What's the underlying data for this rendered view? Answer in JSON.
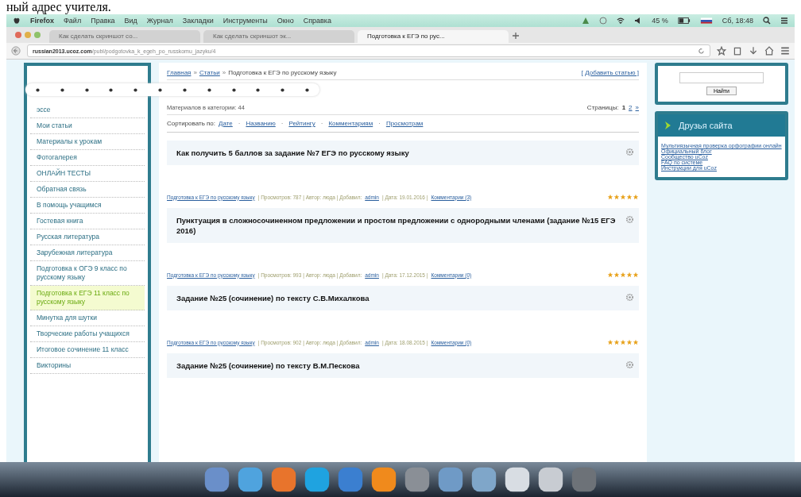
{
  "document_caption": "ный адрес учителя.",
  "menu_bar": {
    "app": "Firefox",
    "items": [
      "Файл",
      "Правка",
      "Вид",
      "Журнал",
      "Закладки",
      "Инструменты",
      "Окно",
      "Справка"
    ],
    "battery": "45 %",
    "clock": "Сб, 18:48"
  },
  "tabs": [
    {
      "title": "Как сделать скриншот со...",
      "selected": false
    },
    {
      "title": "Как сделать скриншот эк...",
      "selected": false
    },
    {
      "title": "Подготовка к ЕГЭ по рус...",
      "selected": true
    }
  ],
  "address_bar": {
    "host": "russian2013.ucoz.com",
    "path": "/publ/podgotovka_k_egeh_po_russkomu_jazyku/4"
  },
  "sidebar": {
    "items": [
      {
        "label": "эссе",
        "selected": false
      },
      {
        "label": "Мои статьи",
        "selected": false
      },
      {
        "label": "Материалы к урокам",
        "selected": false
      },
      {
        "label": "Фотогалерея",
        "selected": false
      },
      {
        "label": "ОНЛАЙН ТЕСТЫ",
        "selected": false
      },
      {
        "label": "Обратная связь",
        "selected": false
      },
      {
        "label": "В помощь учащимся",
        "selected": false
      },
      {
        "label": "Гостевая книга",
        "selected": false
      },
      {
        "label": "Русская литература",
        "selected": false
      },
      {
        "label": "Зарубежная литература",
        "selected": false
      },
      {
        "label": "Подготовка к ОГЭ 9 класс по русскому языку",
        "selected": false
      },
      {
        "label": "Подготовка к ЕГЭ 11 класс по русскому языку",
        "selected": true
      },
      {
        "label": "Минутка для шутки",
        "selected": false
      },
      {
        "label": "Творческие работы учащихся",
        "selected": false
      },
      {
        "label": "Итоговое сочинение 11 класс",
        "selected": false
      },
      {
        "label": "Викторины",
        "selected": false
      }
    ]
  },
  "breadcrumb": {
    "items": [
      "Главная",
      "Статьи",
      "Подготовка к ЕГЭ по русскому языку"
    ],
    "separator": "»"
  },
  "add_article": "[ Добавить статью ]",
  "materials_count": "Материалов в категории: 44",
  "pages": {
    "label": "Страницы:",
    "items": [
      {
        "label": "1",
        "selected": true
      },
      {
        "label": "2",
        "selected": false
      },
      {
        "label": "»",
        "selected": false
      }
    ]
  },
  "sort": {
    "label": "Сортировать по:",
    "options": [
      "Дате",
      "Названию",
      "Рейтингу",
      "Комментариям",
      "Просмотрам"
    ],
    "separator": "·"
  },
  "articles": [
    {
      "title": "Как получить 5 баллов за задание №7 ЕГЭ по русскому языку",
      "category": "Подготовка к ЕГЭ по русскому языку",
      "meta": "| Просмотров: 787 | Автор: люда | Добавил:",
      "author": "admin",
      "date": "| Дата: 19.01.2016 |",
      "comments": "Комментарии (3)",
      "stars": 5
    },
    {
      "title": "Пунктуация в сложносочиненном предложении и простом предложении с однородными членами (задание №15 ЕГЭ 2016)",
      "category": "Подготовка к ЕГЭ по русскому языку",
      "meta": "| Просмотров: 993 | Автор: люда | Добавил:",
      "author": "admin",
      "date": "| Дата: 17.12.2015 |",
      "comments": "Комментарии (0)",
      "stars": 5
    },
    {
      "title": "Задание №25 (сочинение) по тексту С.В.Михалкова",
      "category": "Подготовка к ЕГЭ по русскому языку",
      "meta": "| Просмотров: 902 | Автор: люда | Добавил:",
      "author": "admin",
      "date": "| Дата: 18.08.2015 |",
      "comments": "Комментарии (0)",
      "stars": 5
    },
    {
      "title": "Задание №25 (сочинение) по тексту В.М.Пескова"
    }
  ],
  "search": {
    "button": "Найти"
  },
  "friends": {
    "title": "Друзья сайта",
    "links": [
      "Мультиязычная проверка орфографии онлайн",
      "Официальный блог",
      "Сообщество uCoz",
      "FAQ по системе",
      "Инструкции для uCoz"
    ]
  }
}
